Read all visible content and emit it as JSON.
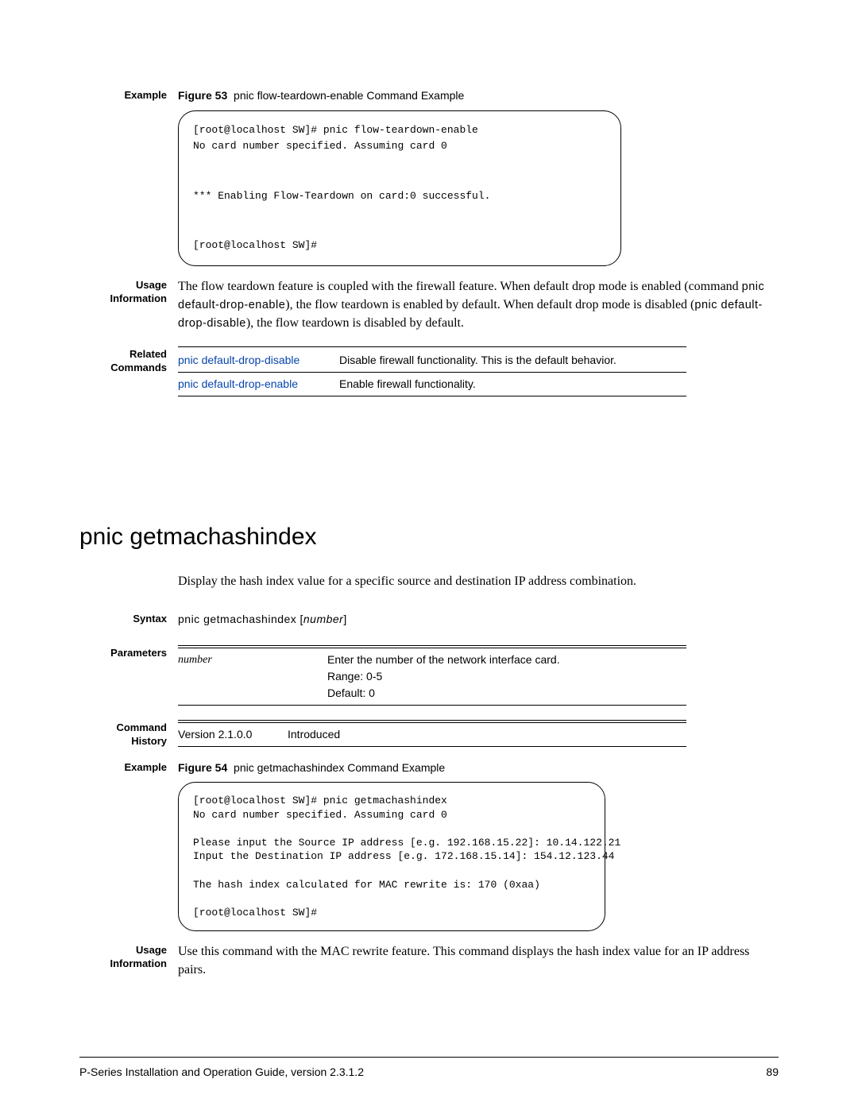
{
  "section1": {
    "example_label": "Example",
    "fig_bold": "Figure 53",
    "fig_caption": "pnic flow-teardown-enable Command Example",
    "code": "[root@localhost SW]# pnic flow-teardown-enable\nNo card number specified. Assuming card 0\n\n\n*** Enabling Flow-Teardown on card:0 successful.\n\n\n[root@localhost SW]#",
    "usage_label1": "Usage",
    "usage_label2": "Information",
    "usage_text_p1a": "The flow teardown feature is coupled with the firewall feature. When default drop mode is enabled (command ",
    "usage_cmd1": "pnic default-drop-enable",
    "usage_text_p1b": "), the flow teardown is enabled by default. When default drop mode is disabled (",
    "usage_cmd2": "pnic default-drop-disable",
    "usage_text_p1c": "), the flow teardown is disabled by default.",
    "related_label1": "Related",
    "related_label2": "Commands",
    "related": [
      {
        "link": "pnic default-drop-disable",
        "desc": "Disable firewall functionality. This is the default behavior."
      },
      {
        "link": "pnic default-drop-enable",
        "desc": "Enable firewall functionality."
      }
    ]
  },
  "section2": {
    "title": "pnic getmachashindex",
    "intro": "Display the hash index value for a specific source and destination IP address combination.",
    "syntax_label": "Syntax",
    "syntax_cmd": "pnic getmachashindex",
    "syntax_arg": "number",
    "syntax_open": "[",
    "syntax_close": "]",
    "params_label": "Parameters",
    "param_name": "number",
    "param_desc1": "Enter the number of the network interface card.",
    "param_desc2": "Range: 0-5",
    "param_desc3": "Default: 0",
    "history_label1": "Command",
    "history_label2": "History",
    "history_version": "Version 2.1.0.0",
    "history_note": "Introduced",
    "example_label": "Example",
    "fig_bold": "Figure 54",
    "fig_caption": "pnic getmachashindex Command Example",
    "code": "[root@localhost SW]# pnic getmachashindex\nNo card number specified. Assuming card 0\n\nPlease input the Source IP address [e.g. 192.168.15.22]: 10.14.122.21\nInput the Destination IP address [e.g. 172.168.15.14]: 154.12.123.44\n\nThe hash index calculated for MAC rewrite is: 170 (0xaa)\n\n[root@localhost SW]#",
    "usage_label1": "Usage",
    "usage_label2": "Information",
    "usage_text": "Use this command with the MAC rewrite feature. This command displays the hash index value for an IP address pairs."
  },
  "footer": {
    "left": "P-Series Installation and Operation Guide, version 2.3.1.2",
    "right": "89"
  }
}
